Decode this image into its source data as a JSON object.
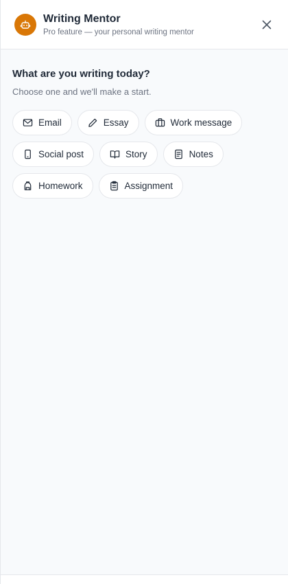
{
  "header": {
    "title": "Writing Mentor",
    "subtitle": "Pro feature — your personal writing mentor",
    "avatar_icon": "robot-icon",
    "avatar_color": "#d97706",
    "close_icon": "close-icon"
  },
  "main": {
    "heading": "What are you writing today?",
    "subheading": "Choose one and we'll make a start.",
    "chips": [
      {
        "label": "Email",
        "icon": "mail-icon"
      },
      {
        "label": "Essay",
        "icon": "pencil-icon"
      },
      {
        "label": "Work message",
        "icon": "briefcase-icon"
      },
      {
        "label": "Social post",
        "icon": "phone-icon"
      },
      {
        "label": "Story",
        "icon": "book-icon"
      },
      {
        "label": "Notes",
        "icon": "notes-icon"
      },
      {
        "label": "Homework",
        "icon": "backpack-icon"
      },
      {
        "label": "Assignment",
        "icon": "clipboard-icon"
      }
    ]
  }
}
